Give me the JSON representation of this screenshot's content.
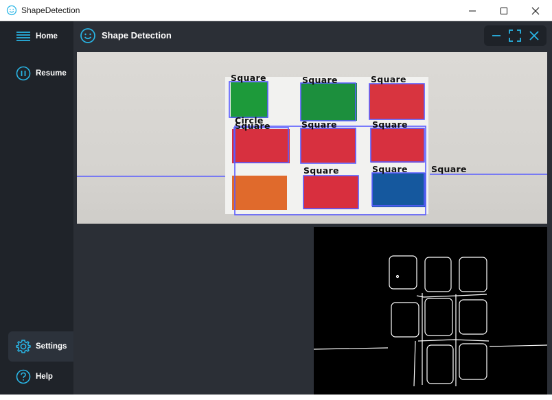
{
  "window": {
    "title": "ShapeDetection"
  },
  "sidebar": {
    "items": [
      {
        "label": "Home",
        "icon": "menu-icon"
      },
      {
        "label": "Resume",
        "icon": "pause-icon"
      },
      {
        "label": "Settings",
        "icon": "gear-icon"
      },
      {
        "label": "Help",
        "icon": "help-icon"
      }
    ],
    "selected": "Settings"
  },
  "header": {
    "title": "Shape Detection",
    "icon": "smiley-icon"
  },
  "detections": {
    "labels": [
      "Square",
      "Square",
      "Square",
      "Circle",
      "Square",
      "Square",
      "Square",
      "Square",
      "Square",
      "Square"
    ]
  },
  "colors": {
    "accent": "#29b6e6",
    "sidebar_bg": "#1f2329",
    "content_bg": "#2b2f36",
    "detection_outline": "#5a5cff"
  }
}
